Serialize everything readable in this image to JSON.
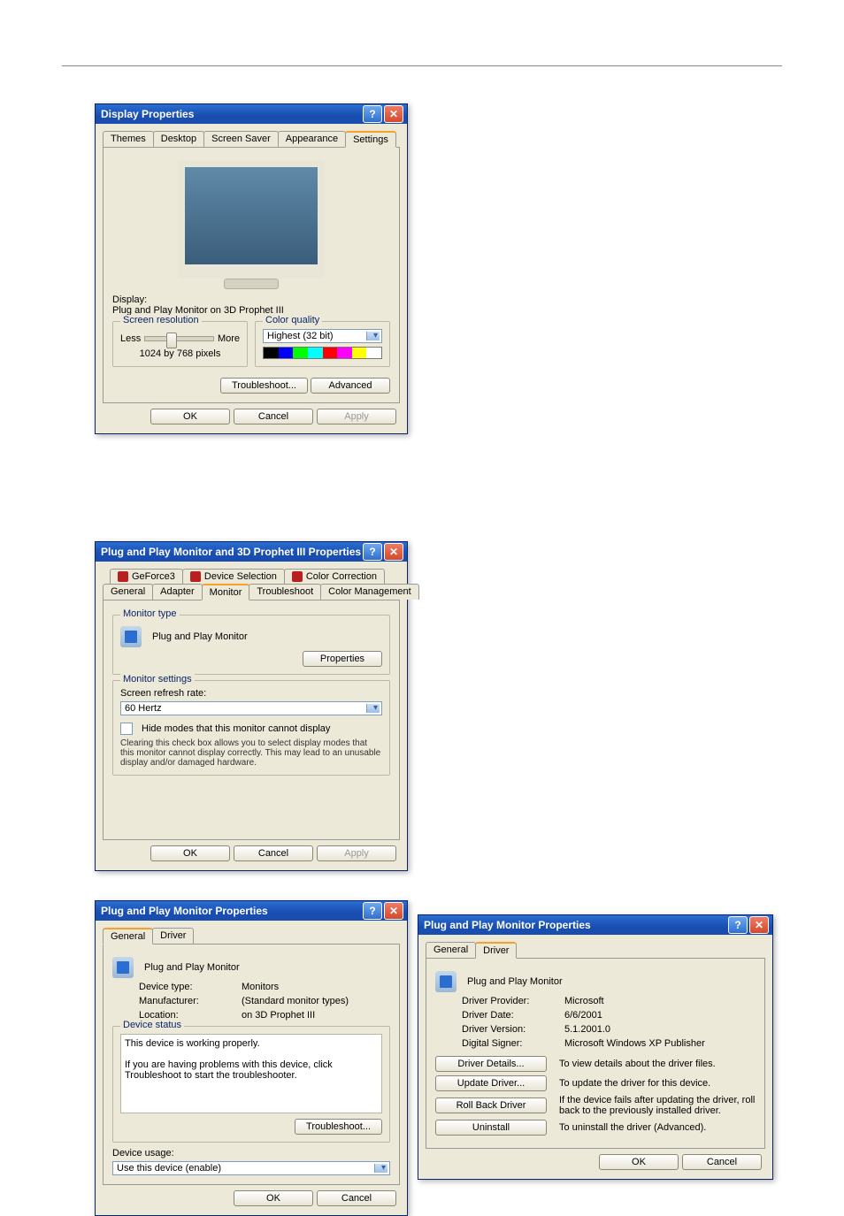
{
  "dialog1": {
    "title": "Display Properties",
    "tabs": [
      "Themes",
      "Desktop",
      "Screen Saver",
      "Appearance",
      "Settings"
    ],
    "active_tab": "Settings",
    "display_label": "Display:",
    "display_text": "Plug and Play Monitor on 3D Prophet III",
    "res_legend": "Screen resolution",
    "less": "Less",
    "more": "More",
    "res_value": "1024 by 768 pixels",
    "quality_legend": "Color quality",
    "quality_value": "Highest (32 bit)",
    "troubleshoot": "Troubleshoot...",
    "advanced": "Advanced",
    "ok": "OK",
    "cancel": "Cancel",
    "apply": "Apply"
  },
  "dialog2": {
    "title": "Plug and Play Monitor and 3D Prophet III Properties",
    "tabs_row1": [
      "GeForce3",
      "Device Selection",
      "Color Correction"
    ],
    "tabs_row2": [
      "General",
      "Adapter",
      "Monitor",
      "Troubleshoot",
      "Color Management"
    ],
    "active_tab": "Monitor",
    "type_legend": "Monitor type",
    "monitor_name": "Plug and Play Monitor",
    "properties": "Properties",
    "settings_legend": "Monitor settings",
    "refresh_label": "Screen refresh rate:",
    "refresh_value": "60 Hertz",
    "hide_modes": "Hide modes that this monitor cannot display",
    "hide_desc": "Clearing this check box allows you to select display modes that this monitor cannot display correctly. This may lead to an unusable display and/or damaged hardware.",
    "ok": "OK",
    "cancel": "Cancel",
    "apply": "Apply"
  },
  "dialog3": {
    "title": "Plug and Play Monitor Properties",
    "tabs": [
      "General",
      "Driver"
    ],
    "active_tab": "General",
    "device_name": "Plug and Play Monitor",
    "device_type_l": "Device type:",
    "device_type_v": "Monitors",
    "manufacturer_l": "Manufacturer:",
    "manufacturer_v": "(Standard monitor types)",
    "location_l": "Location:",
    "location_v": "on 3D Prophet III",
    "status_legend": "Device status",
    "status_line1": "This device is working properly.",
    "status_line2": "If you are having problems with this device, click Troubleshoot to start the troubleshooter.",
    "troubleshoot": "Troubleshoot...",
    "usage_label": "Device usage:",
    "usage_value": "Use this device (enable)",
    "ok": "OK",
    "cancel": "Cancel"
  },
  "dialog4": {
    "title": "Plug and Play Monitor Properties",
    "tabs": [
      "General",
      "Driver"
    ],
    "active_tab": "Driver",
    "device_name": "Plug and Play Monitor",
    "provider_l": "Driver Provider:",
    "provider_v": "Microsoft",
    "date_l": "Driver Date:",
    "date_v": "6/6/2001",
    "version_l": "Driver Version:",
    "version_v": "5.1.2001.0",
    "signer_l": "Digital Signer:",
    "signer_v": "Microsoft Windows XP Publisher",
    "details_btn": "Driver Details...",
    "details_desc": "To view details about the driver files.",
    "update_btn": "Update Driver...",
    "update_desc": "To update the driver for this device.",
    "rollback_btn": "Roll Back Driver",
    "rollback_desc": "If the device fails after updating the driver, roll back to the previously installed driver.",
    "uninstall_btn": "Uninstall",
    "uninstall_desc": "To uninstall the driver (Advanced).",
    "ok": "OK",
    "cancel": "Cancel"
  }
}
